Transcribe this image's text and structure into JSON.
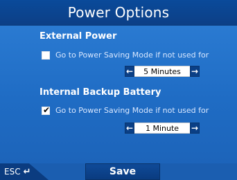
{
  "header": {
    "title": "Power Options"
  },
  "external": {
    "section_label": "External Power",
    "checkbox_checked": false,
    "option_label": "Go to Power Saving Mode if not used for",
    "value": "5 Minutes"
  },
  "internal": {
    "section_label": "Internal Backup Battery",
    "checkbox_checked": true,
    "checkbox_mark": "✔",
    "option_label": "Go to Power Saving Mode if not used for",
    "value": "1 Minute"
  },
  "icons": {
    "decrement": "left-arrow-icon",
    "increment": "right-arrow-icon",
    "back": "return-arrow-icon"
  },
  "footer": {
    "esc_label": "ESC",
    "esc_icon": "↵",
    "save_label": "Save"
  }
}
